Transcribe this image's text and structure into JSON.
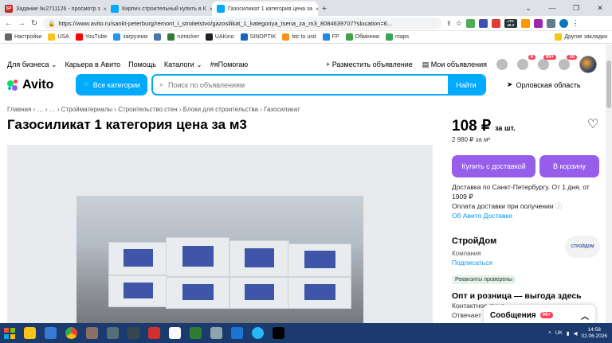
{
  "browser": {
    "tabs": [
      {
        "icon": "SP",
        "label": "Задание №2711126 - просмотр з",
        "color": "#c62828"
      },
      {
        "icon": "A",
        "label": "Кирпич строительный купить в К",
        "color": "#00aaff"
      },
      {
        "icon": "A",
        "label": "Газосиликат 1 категория цена за",
        "color": "#00aaff"
      }
    ],
    "url": "https://www.avito.ru/sankt-peterburg/remont_i_stroitelstvo/gazosilikat_1_kategoriya_tsena_za_m3_8084639707?slocation=6...",
    "extensions": [
      "LTC",
      "40.3"
    ],
    "bookmarks": [
      "Настройки",
      "USA",
      "YouTube",
      "загрузник",
      "rutracker",
      "UAKino",
      "SINOPTIK",
      "btc to usd",
      "FP",
      "Обмінник",
      "maps"
    ],
    "other_bookmarks": "Другие закладки"
  },
  "site": {
    "nav": [
      "Для бизнеса",
      "Карьера в Авито",
      "Помощь",
      "Каталоги",
      "#яПомогаю"
    ],
    "post_ad": "Разместить объявление",
    "my_ads": "Мои объявления",
    "badges": [
      "6",
      "99+",
      "10"
    ],
    "logo": "Avito",
    "all_categories": "Все категории",
    "search_placeholder": "Поиск по объявлениям",
    "search_button": "Найти",
    "region": "Орловская область"
  },
  "breadcrumbs": "Главная › … › … › Стройматериалы › Строительство стен › Блоки для строительства › Газосиликат",
  "listing": {
    "title": "Газосиликат 1 категория цена за м3",
    "price": "108 ₽",
    "price_unit": "за шт.",
    "price_m3": "2 980 ₽ за м³",
    "buy_button": "Купить с доставкой",
    "cart_button": "В корзину",
    "delivery_text": "Доставка по Санкт-Петербургу. От 1 дня, от 1909 ₽",
    "payment_text": "Оплата доставки при получении",
    "delivery_link": "Об Авито Доставке"
  },
  "seller": {
    "name": "СтройДом",
    "type": "Компания",
    "subscribe": "Подписаться",
    "logo_text": "СТРОЙДОМ",
    "verified": "Реквизиты проверены",
    "promo": "Опт и розница — выгода здесь",
    "contact": "Контактное лицо",
    "answers": "Отвечает"
  },
  "messages": {
    "label": "Сообщения",
    "badge": "99+"
  },
  "system": {
    "lang": "UK",
    "time": "14:58",
    "date": "02.06.2026"
  }
}
